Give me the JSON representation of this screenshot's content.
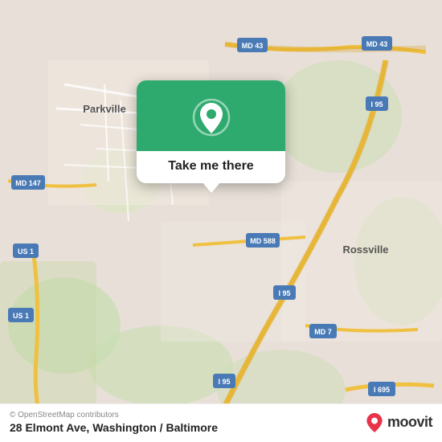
{
  "map": {
    "background_color": "#e8e0d8",
    "alt": "Map of Baltimore/Washington area showing Parkville, Rossville, MD 43, MD 147, US 1, I-95, MD 588, MD 7, I-695"
  },
  "popup": {
    "button_label": "Take me there",
    "icon_semantic": "location-pin-icon"
  },
  "bottom_bar": {
    "copyright": "© OpenStreetMap contributors",
    "address": "28 Elmont Ave, Washington / Baltimore",
    "brand": "moovit"
  }
}
